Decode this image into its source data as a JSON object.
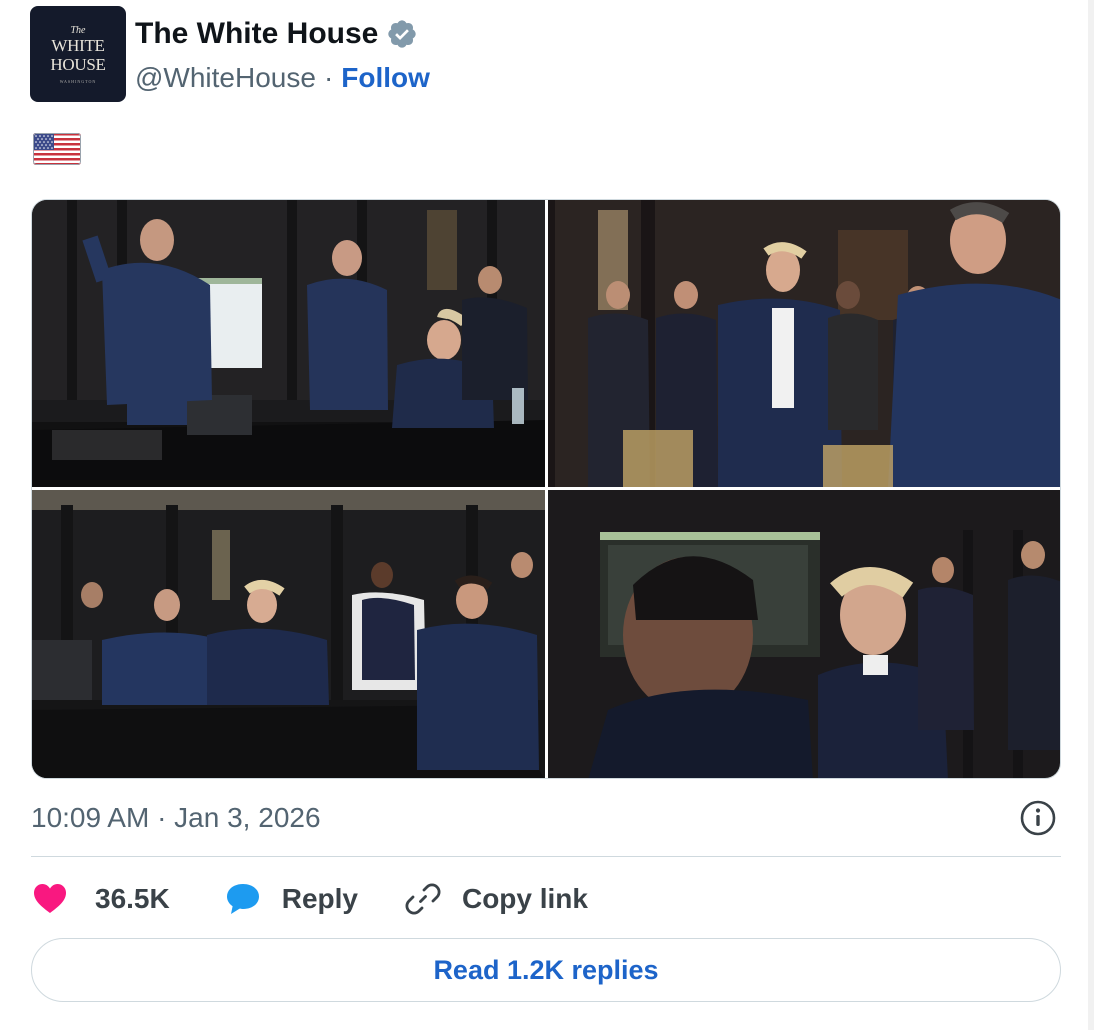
{
  "account": {
    "display_name": "The White House",
    "handle": "@WhiteHouse",
    "separator": "·",
    "follow_label": "Follow",
    "verified_color": "#829aab",
    "avatar": {
      "line1": "The",
      "line2": "WHITE",
      "line3": "HOUSE",
      "line4": "WASHINGTON",
      "background": "#141a2b"
    }
  },
  "tweet": {
    "text_emoji": "flag-usa-icon",
    "photos_count": 4,
    "timestamp": "10:09 AM · Jan 3, 2026"
  },
  "actions": {
    "like_count": "36.5K",
    "like_color": "#f91880",
    "reply_label": "Reply",
    "reply_color": "#1d9bf0",
    "copy_label": "Copy link"
  },
  "read_replies_label": "Read 1.2K replies",
  "accent_color": "#1d64c9"
}
